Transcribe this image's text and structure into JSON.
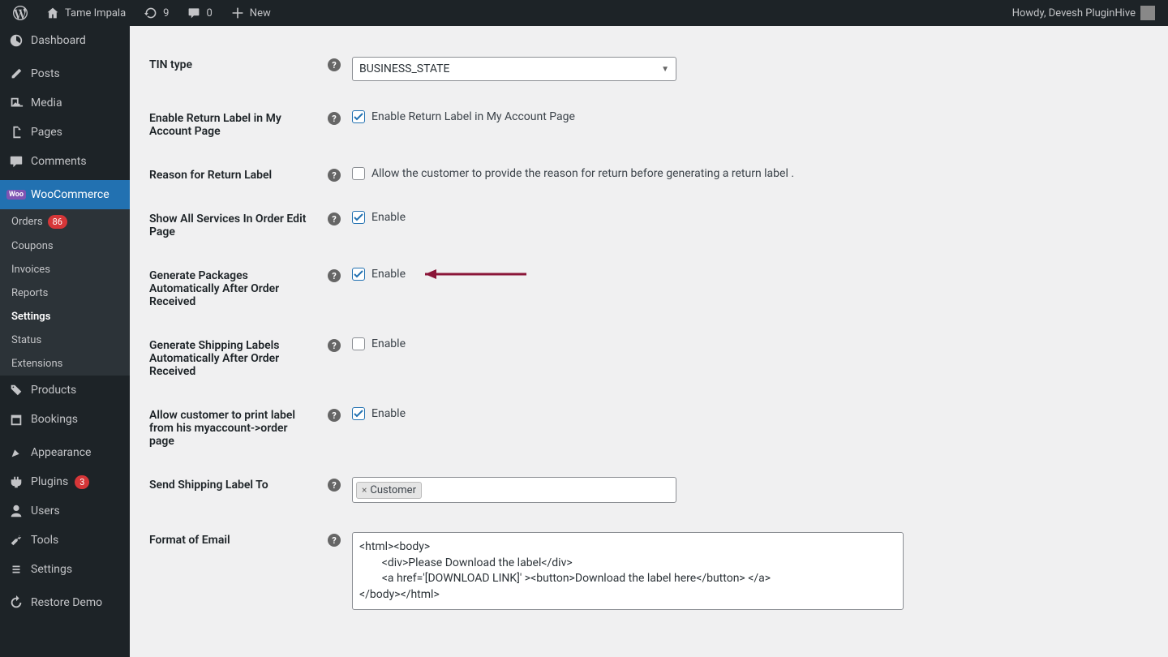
{
  "adminbar": {
    "site_name": "Tame Impala",
    "updates": "9",
    "comments": "0",
    "new_label": "New",
    "howdy": "Howdy, Devesh PluginHive"
  },
  "sidebar": {
    "items": [
      {
        "id": "dashboard",
        "label": "Dashboard",
        "icon": "dashboard"
      },
      {
        "id": "posts",
        "label": "Posts",
        "icon": "pin"
      },
      {
        "id": "media",
        "label": "Media",
        "icon": "media"
      },
      {
        "id": "pages",
        "label": "Pages",
        "icon": "pages"
      },
      {
        "id": "comments",
        "label": "Comments",
        "icon": "comment"
      },
      {
        "id": "woocommerce",
        "label": "WooCommerce",
        "icon": "woo",
        "current": true
      },
      {
        "id": "products",
        "label": "Products",
        "icon": "products"
      },
      {
        "id": "bookings",
        "label": "Bookings",
        "icon": "calendar"
      },
      {
        "id": "appearance",
        "label": "Appearance",
        "icon": "appearance"
      },
      {
        "id": "plugins",
        "label": "Plugins",
        "icon": "plugin",
        "badge": "3"
      },
      {
        "id": "users",
        "label": "Users",
        "icon": "user"
      },
      {
        "id": "tools",
        "label": "Tools",
        "icon": "tools"
      },
      {
        "id": "settings",
        "label": "Settings",
        "icon": "settings"
      },
      {
        "id": "restore",
        "label": "Restore Demo",
        "icon": "restore"
      }
    ],
    "submenu": [
      {
        "id": "orders",
        "label": "Orders",
        "badge": "86"
      },
      {
        "id": "coupons",
        "label": "Coupons"
      },
      {
        "id": "invoices",
        "label": "Invoices"
      },
      {
        "id": "reports",
        "label": "Reports"
      },
      {
        "id": "settings",
        "label": "Settings",
        "active": true
      },
      {
        "id": "status",
        "label": "Status"
      },
      {
        "id": "extensions",
        "label": "Extensions"
      }
    ]
  },
  "settings": {
    "tin_type": {
      "label": "TIN type",
      "value": "BUSINESS_STATE"
    },
    "return_label": {
      "label": "Enable Return Label in My Account Page",
      "checkbox_label": "Enable Return Label in My Account Page",
      "checked": true
    },
    "reason_return": {
      "label": "Reason for Return Label",
      "checkbox_label": "Allow the customer to provide the reason for return before generating a return label .",
      "checked": false
    },
    "show_services": {
      "label": "Show All Services In Order Edit Page",
      "checkbox_label": "Enable",
      "checked": true
    },
    "gen_packages": {
      "label": "Generate Packages Automatically After Order Received",
      "checkbox_label": "Enable",
      "checked": true
    },
    "gen_labels": {
      "label": "Generate Shipping Labels Automatically After Order Received",
      "checkbox_label": "Enable",
      "checked": false
    },
    "allow_print": {
      "label": "Allow customer to print label from his myaccount->order page",
      "checkbox_label": "Enable",
      "checked": true
    },
    "send_to": {
      "label": "Send Shipping Label To",
      "tag": "Customer"
    },
    "email_format": {
      "label": "Format of Email",
      "value": "<html><body>\n        <div>Please Download the label</div>\n        <a href='[DOWNLOAD LINK]' ><button>Download the label here</button> </a>\n</body></html>"
    }
  }
}
